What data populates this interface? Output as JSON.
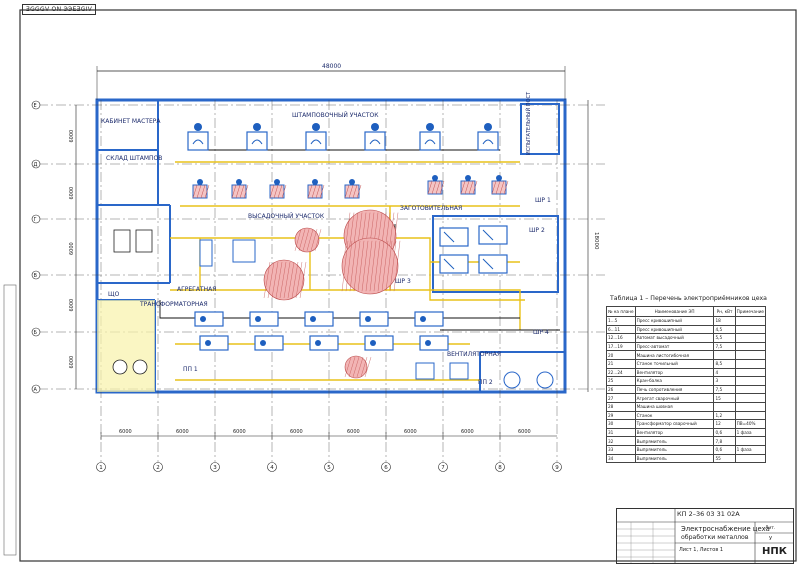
{
  "corner_stamp": "ƎGGGV ON ЭЭEƎGIV",
  "plan": {
    "overall_dim": "48000",
    "right_dim": "18000",
    "left_dims": [
      "6000",
      "6000",
      "6000",
      "6000",
      "6000",
      "6000"
    ],
    "bottom_dims": [
      "6000",
      "6000",
      "6000",
      "6000",
      "6000",
      "6000",
      "6000",
      "6000"
    ],
    "axes_letters": [
      "Е",
      "Д",
      "Г",
      "В",
      "Б",
      "А"
    ],
    "axes_numbers": [
      "1",
      "2",
      "3",
      "4",
      "5",
      "6",
      "7",
      "8",
      "9"
    ],
    "rooms": {
      "stamping": "ШТАМПОВОЧНЫЙ УЧАСТОК",
      "office": "КАБИНЕТ МАСТЕРА",
      "storage": "СКЛАД ШТАМПОВ",
      "inspection": "ИСПЫТАТЕЛЬНЫЙ ПОСТ",
      "forging": "ВЫСАДОЧНЫЙ УЧАСТОК",
      "aggregate": "АГРЕГАТНАЯ",
      "transformer": "ТРАНСФОРМАТОРНАЯ",
      "cutting": "ЗАГОТОВИТЕЛЬНАЯ",
      "compressor": "ВЕНТИЛЯТОРНАЯ"
    },
    "panels": [
      "ШР 1",
      "ШР 2",
      "ШР 3",
      "ШР 4",
      "ПП 1",
      "ПП 2",
      "ЩО"
    ]
  },
  "table": {
    "title": "Таблица 1 – Перечень электроприёмников цеха",
    "headers": [
      "№ на плане",
      "Наименование ЭП",
      "Рн, кВт",
      "Примечание"
    ],
    "rows": [
      [
        "1...5",
        "Пресс кривошипный",
        "18",
        ""
      ],
      [
        "6...11",
        "Пресс кривошипный",
        "4,5",
        ""
      ],
      [
        "12...16",
        "Автомат высадочный",
        "5,5",
        ""
      ],
      [
        "17...19",
        "Пресс-автомат",
        "7,5",
        ""
      ],
      [
        "20",
        "Машина листогибочная",
        "",
        ""
      ],
      [
        "21",
        "Станок точильный",
        "8,5",
        ""
      ],
      [
        "22...24",
        "Вентилятор",
        "4",
        ""
      ],
      [
        "25",
        "Кран-балка",
        "3",
        ""
      ],
      [
        "26",
        "Печь сопротивления",
        "7,5",
        ""
      ],
      [
        "27",
        "Агрегат сварочный",
        "15",
        ""
      ],
      [
        "28",
        "Машина шовная",
        "",
        ""
      ],
      [
        "29",
        "Станок",
        "1,2",
        ""
      ],
      [
        "30",
        "Трансформатор сварочный",
        "12",
        "ПВ=40%"
      ],
      [
        "31",
        "Вентилятор",
        "0,6",
        "1 фаза"
      ],
      [
        "32",
        "Выпрямитель",
        "7,8",
        ""
      ],
      [
        "33",
        "Выпрямитель",
        "0,6",
        "1 фаза"
      ],
      [
        "34",
        "Выпрямитель",
        "55",
        ""
      ]
    ]
  },
  "title_block": {
    "code": "КП 2–36 03 31 02А",
    "name_line1": "Электроснабжение цеха",
    "name_line2": "обработки металлов",
    "sheet_text": "Лист 1, Листов 1",
    "stage_label": "Лит.",
    "stage_value": "У",
    "org": "НПК"
  }
}
